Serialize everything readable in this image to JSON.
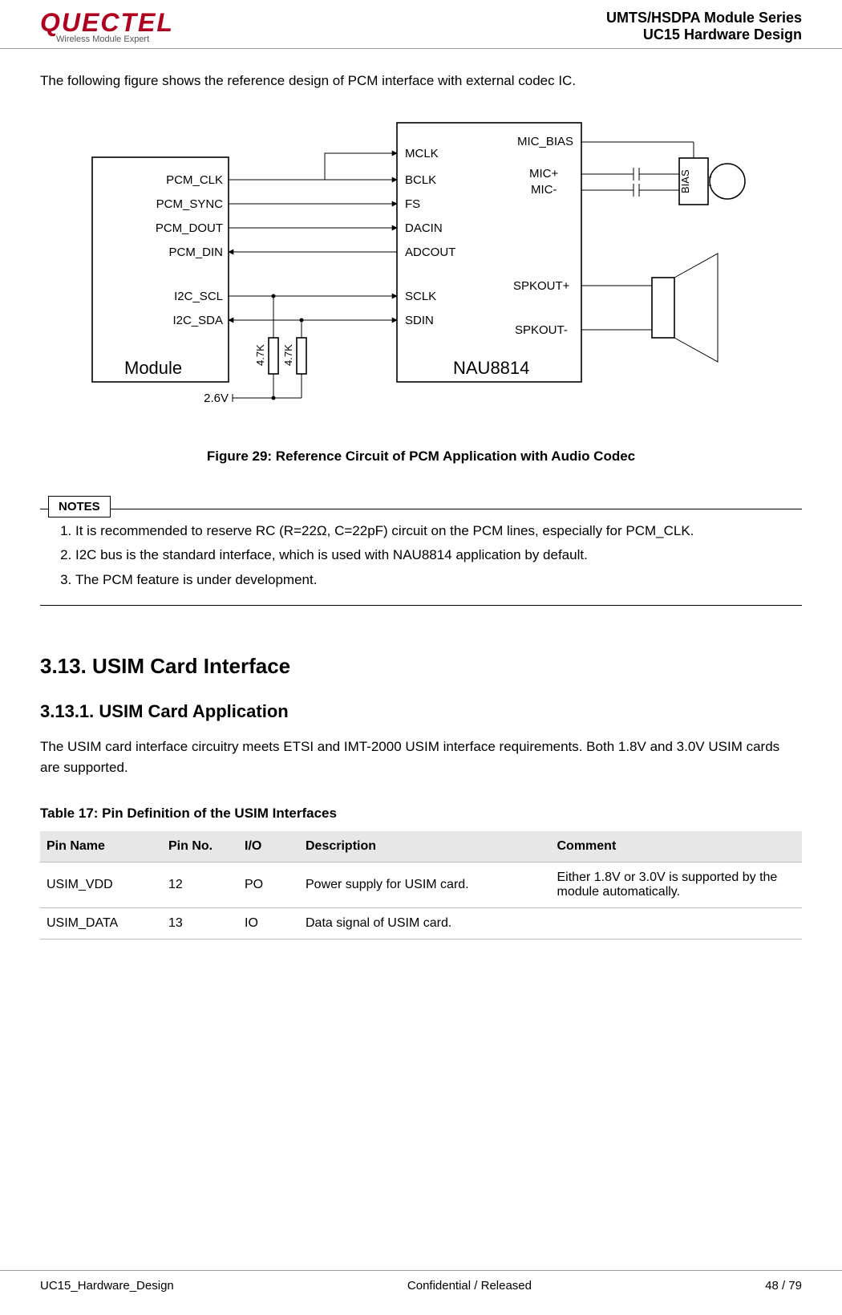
{
  "header": {
    "logo_brand": "QUECTEL",
    "logo_tagline": "Wireless Module Expert",
    "series1": "UMTS/HSDPA  Module  Series",
    "series2": "UC15  Hardware  Design"
  },
  "intro": "The following figure shows the reference design of PCM interface with external codec IC.",
  "diagram": {
    "module": "Module",
    "module_pins": [
      "PCM_CLK",
      "PCM_SYNC",
      "PCM_DOUT",
      "PCM_DIN",
      "I2C_SCL",
      "I2C_SDA"
    ],
    "resistor_val": "4.7K",
    "vref": "2.6V",
    "codec": "NAU8814",
    "codec_left_pins": [
      "MCLK",
      "BCLK",
      "FS",
      "DACIN",
      "ADCOUT",
      "SCLK",
      "SDIN"
    ],
    "codec_right_labels": {
      "mic_bias": "MIC_BIAS",
      "mic_p": "MIC+",
      "mic_n": "MIC-",
      "bias": "BIAS",
      "spk_p": "SPKOUT+",
      "spk_n": "SPKOUT-"
    }
  },
  "figcaption": "Figure 29: Reference Circuit of PCM Application with Audio Codec",
  "notes": {
    "label": "NOTES",
    "items": [
      "It is recommended to reserve RC (R=22Ω, C=22pF) circuit on the PCM lines, especially for PCM_CLK.",
      "I2C bus is the standard interface, which is used with NAU8814 application by default.",
      "The PCM feature is under development."
    ]
  },
  "h2": "3.13. USIM Card Interface",
  "h3": "3.13.1.    USIM Card Application",
  "body": "The USIM card interface circuitry meets ETSI and IMT-2000 USIM interface requirements. Both 1.8V and 3.0V USIM cards are supported.",
  "tablecaption": "Table 17: Pin Definition of the USIM Interfaces",
  "table": {
    "headers": [
      "Pin Name",
      "Pin No.",
      "I/O",
      "Description",
      "Comment"
    ],
    "rows": [
      {
        "name": "USIM_VDD",
        "no": "12",
        "io": "PO",
        "desc": "Power supply for USIM card.",
        "comment": "Either 1.8V or 3.0V is supported by the module automatically."
      },
      {
        "name": "USIM_DATA",
        "no": "13",
        "io": "IO",
        "desc": "Data signal of USIM card.",
        "comment": ""
      }
    ]
  },
  "footer": {
    "left": "UC15_Hardware_Design",
    "center": "Confidential / Released",
    "right": "48 / 79"
  }
}
